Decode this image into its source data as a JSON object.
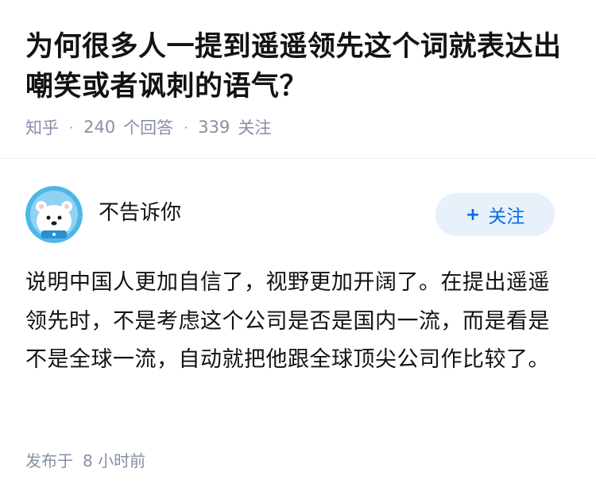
{
  "question": {
    "title": "为何很多人一提到遥遥领先这个词就表达出嘲笑或者讽刺的语气？",
    "source": "知乎",
    "answers_count": "240",
    "answers_label": "个回答",
    "followers_count": "339",
    "followers_label": "关注"
  },
  "answer": {
    "author_name": "不告诉你",
    "follow_button_plus": "+",
    "follow_button_label": "关注",
    "content": "说明中国人更加自信了，视野更加开阔了。在提出遥遥领先时，不是考虑这个公司是否是国内一流，而是看是不是全球一流，自动就把他跟全球顶尖公司作比较了。",
    "published_prefix": "发布于",
    "published_time": "8 小时前"
  },
  "colors": {
    "title": "#121212",
    "meta": "#8590a6",
    "follow_bg": "#e8f0fa",
    "follow_text": "#056de8",
    "avatar_bg": "#4fb6e8"
  }
}
